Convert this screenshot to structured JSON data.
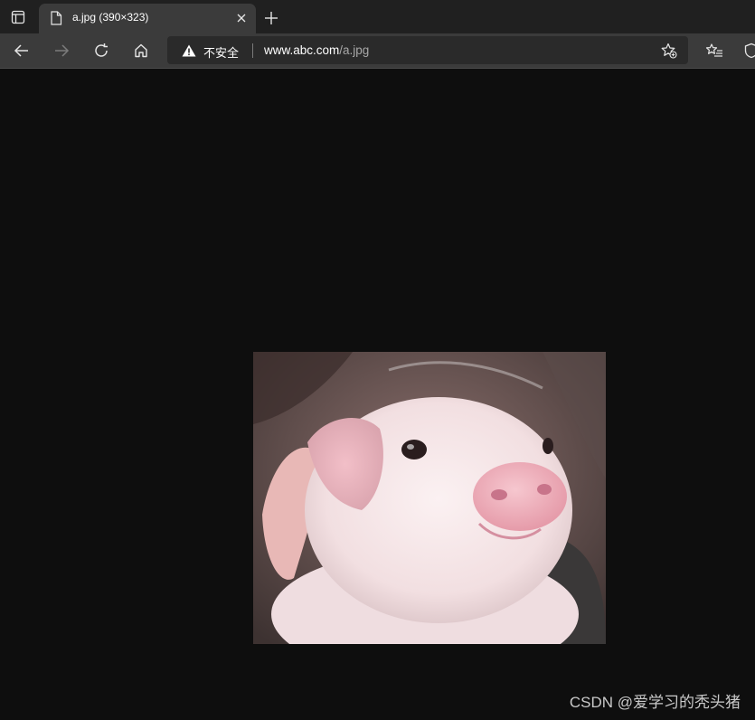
{
  "tab": {
    "title": "a.jpg (390×323)",
    "favicon": "file-icon",
    "close_icon": "close-icon"
  },
  "tabbar": {
    "actions_icon": "tab-actions-icon",
    "new_tab_icon": "plus-icon"
  },
  "toolbar": {
    "back_icon": "arrow-left-icon",
    "forward_icon": "arrow-right-icon",
    "refresh_icon": "refresh-icon",
    "home_icon": "home-icon",
    "favorites_icon": "favorites-list-icon",
    "collections_icon": "collections-icon"
  },
  "address_bar": {
    "security_icon": "warning-triangle-icon",
    "security_label": "不安全",
    "url_host": "www.abc.com",
    "url_path": "/a.jpg",
    "add_favorite_icon": "star-add-icon"
  },
  "content": {
    "image_description": "pig-photo"
  },
  "watermark": {
    "text": "CSDN @爱学习的秃头猪"
  },
  "colors": {
    "tabbar_bg": "#202020",
    "toolbar_bg": "#3b3b3b",
    "page_bg": "#0e0e0e"
  }
}
